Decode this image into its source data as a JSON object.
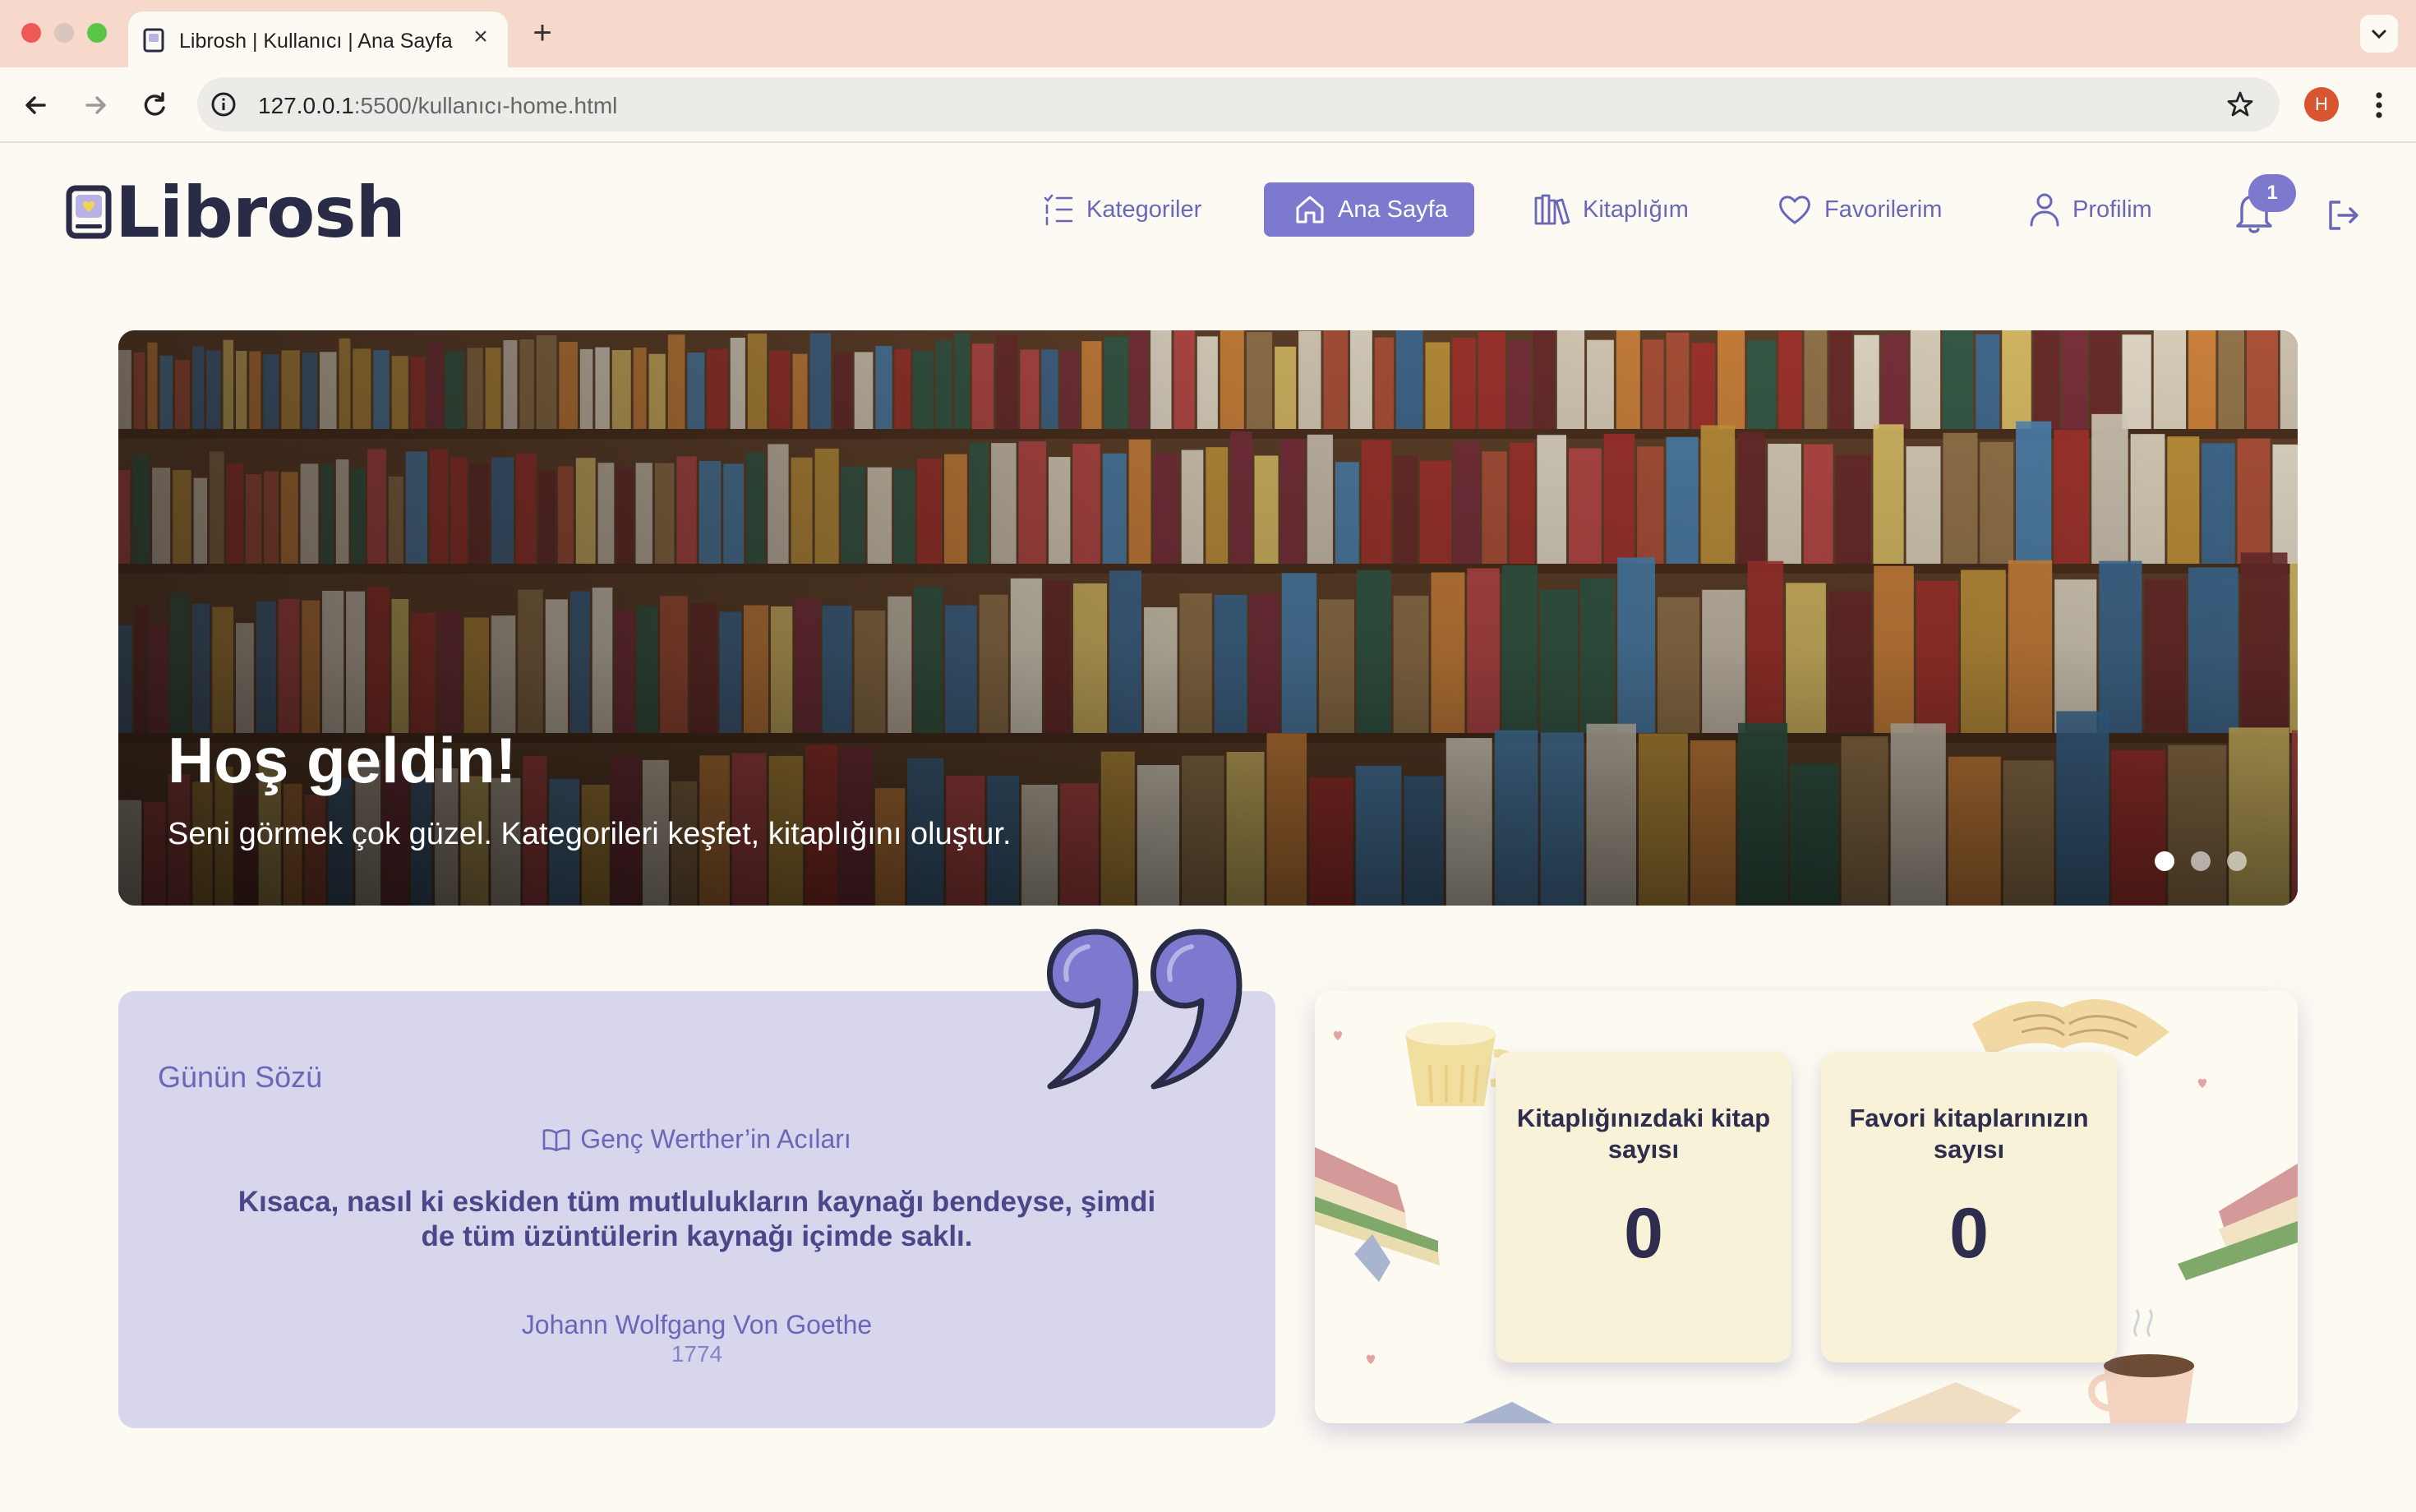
{
  "browser": {
    "tab_title": "Librosh | Kullanıcı | Ana Sayfa",
    "url_host": "127.0.0.1",
    "url_path": ":5500/kullanıcı-home.html",
    "profile_initial": "H"
  },
  "site": {
    "logo_text": "Librosh",
    "nav": {
      "categories": "Kategoriler",
      "home": "Ana Sayfa",
      "library": "Kitaplığım",
      "favorites": "Favorilerim",
      "profile": "Profilim"
    },
    "notification_count": "1"
  },
  "hero": {
    "title": "Hoş geldin!",
    "subtitle": "Seni görmek çok güzel. Kategorileri keşfet, kitaplığını oluştur.",
    "slides": 3,
    "active_slide": 1
  },
  "quote": {
    "heading": "Günün Sözü",
    "book": "Genç Werther’in Acıları",
    "text": "Kısaca, nasıl ki eskiden tüm mutlulukların kaynağı bendeyse, şimdi de tüm üzüntülerin kaynağı içimde saklı.",
    "author": "Johann Wolfgang Von Goethe",
    "year": "1774"
  },
  "stats": {
    "library_label": "Kitaplığınızdaki kitap sayısı",
    "library_count": "0",
    "favorites_label": "Favori kitaplarınızın sayısı",
    "favorites_count": "0"
  },
  "colors": {
    "accent": "#7d79cf",
    "logo": "#2a2b46",
    "page_bg": "#fcfaf3",
    "quote_bg": "#d7d6ed",
    "stat_box_bg": "#f8f2d8"
  }
}
